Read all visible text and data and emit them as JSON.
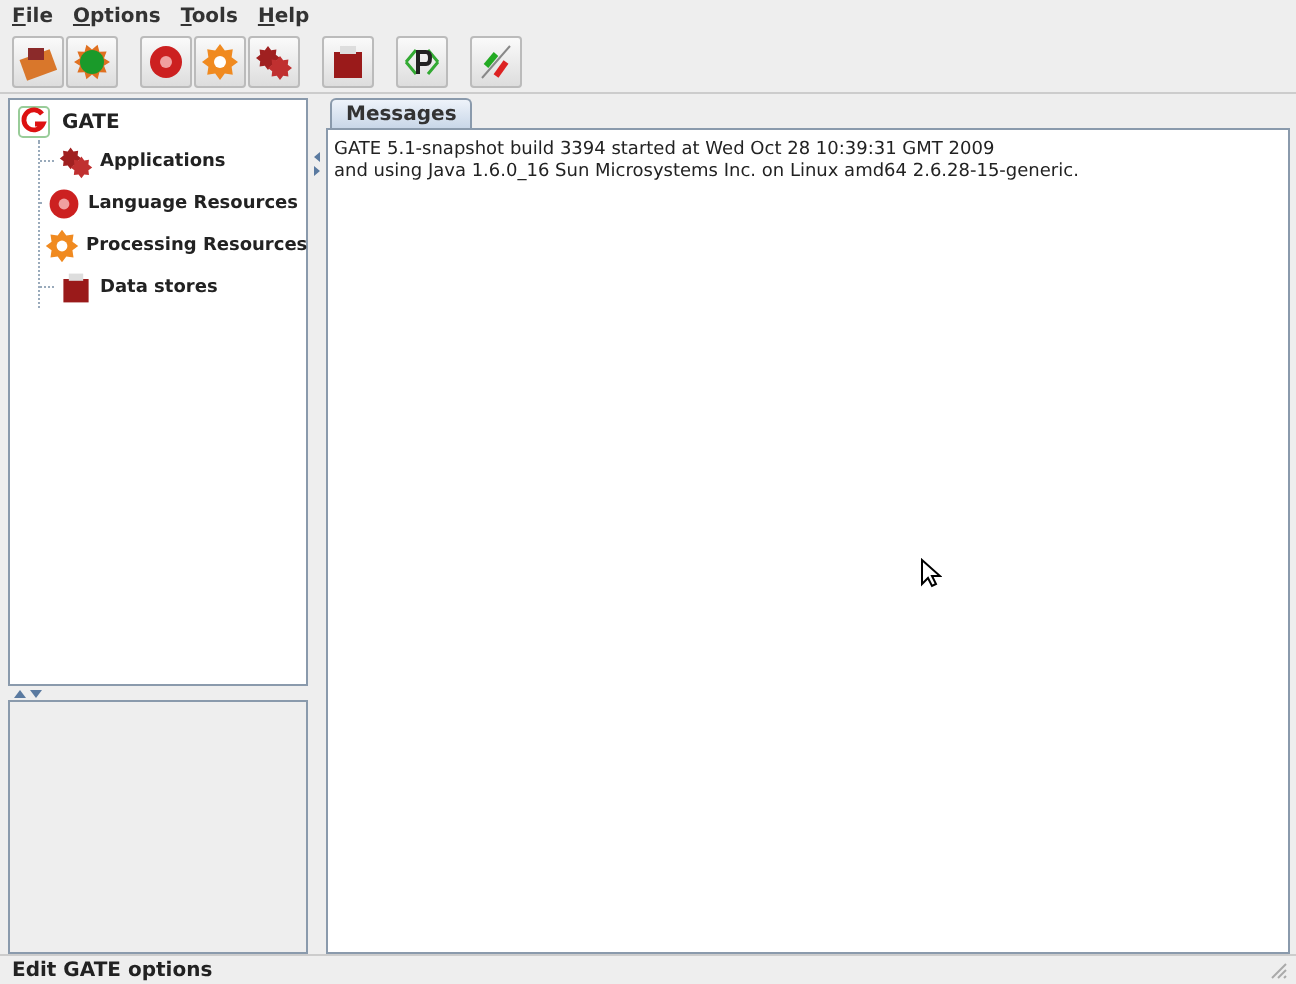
{
  "menu": [
    "File",
    "Options",
    "Tools",
    "Help"
  ],
  "toolbar": [
    {
      "kind": "load"
    },
    {
      "kind": "app"
    },
    {
      "kind": "lr"
    },
    {
      "kind": "pr"
    },
    {
      "kind": "apps"
    },
    {
      "kind": "ds"
    },
    {
      "kind": "plugin"
    },
    {
      "kind": "edit"
    }
  ],
  "tree": {
    "label": "GATE",
    "expanded": true,
    "children": [
      {
        "label": "Applications",
        "kind": "apps"
      },
      {
        "label": "Language Resources",
        "kind": "lr"
      },
      {
        "label": "Processing Resources",
        "kind": "pr"
      },
      {
        "label": "Data stores",
        "kind": "ds"
      }
    ]
  },
  "tabs": [
    {
      "label": "Messages",
      "selected": true
    }
  ],
  "messages": [
    "GATE 5.1-snapshot build 3394 started at Wed Oct 28 10:39:31 GMT 2009",
    "and using Java 1.6.0_16 Sun Microsystems Inc. on Linux amd64 2.6.28-15-generic."
  ],
  "status_bar": "Edit GATE options"
}
